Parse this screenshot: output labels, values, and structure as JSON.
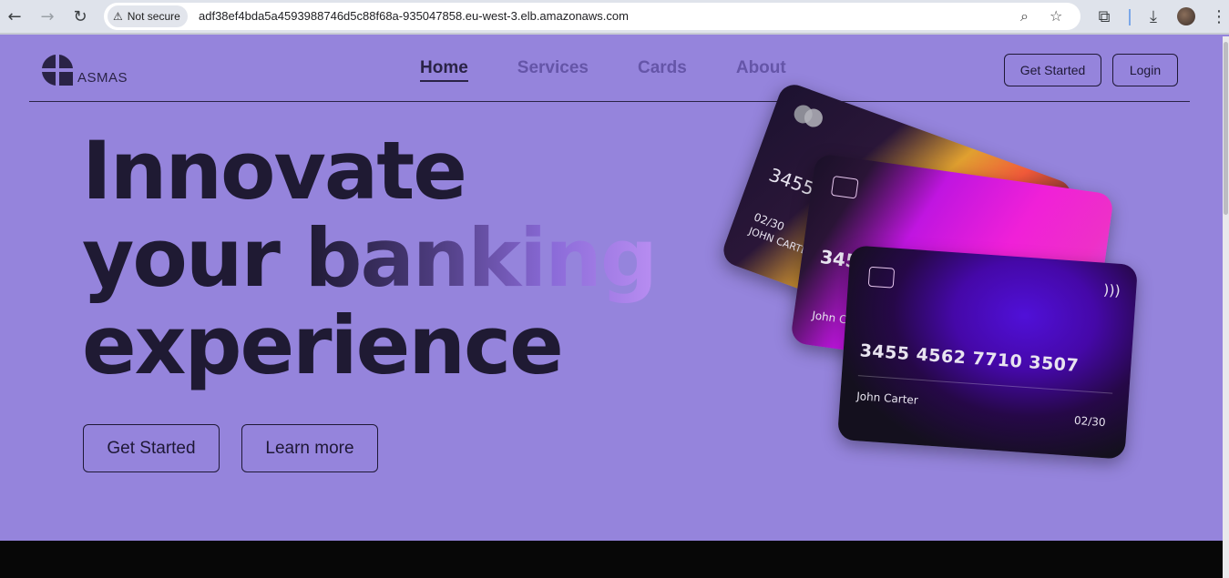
{
  "browser": {
    "security_label": "Not secure",
    "url": "adf38ef4bda5a4593988746d5c88f68a-935047858.eu-west-3.elb.amazonaws.com"
  },
  "brand": {
    "name": "ASMAS",
    "logo": "quartered-circle-logo"
  },
  "nav": {
    "items": [
      {
        "label": "Home",
        "active": true
      },
      {
        "label": "Services",
        "active": false
      },
      {
        "label": "Cards",
        "active": false
      },
      {
        "label": "About",
        "active": false
      }
    ]
  },
  "header_buttons": {
    "get_started": "Get Started",
    "login": "Login"
  },
  "hero": {
    "line1": "Innovate",
    "line2_plain": "your ",
    "line2_gradient": "banking",
    "line3": "experience",
    "cta_primary": "Get Started",
    "cta_secondary": "Learn more"
  },
  "cards": {
    "back_number_partial": "3455",
    "back_expiry": "02/30",
    "back_name": "JOHN CARTER",
    "middle_number_partial": "345",
    "middle_name_partial": "John Ca",
    "front_number": "3455 4562 7710 3507",
    "front_name": "John Carter",
    "front_expiry": "02/30"
  },
  "colors": {
    "page_background": "#9584dc",
    "text_dark": "#1f1a33",
    "footer": "#070707"
  }
}
